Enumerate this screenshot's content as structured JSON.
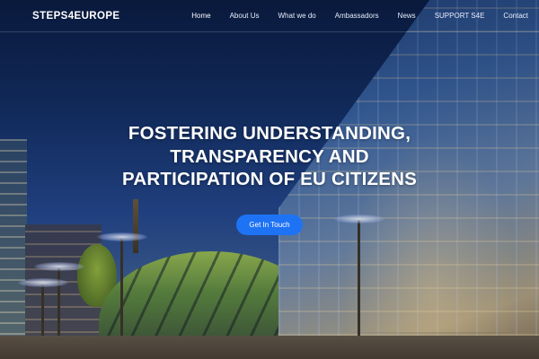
{
  "brand": {
    "logo_text": "STEPS4EUROPE"
  },
  "nav": {
    "items": [
      {
        "label": "Home",
        "active": true
      },
      {
        "label": "About Us",
        "active": false
      },
      {
        "label": "What we do",
        "active": false
      },
      {
        "label": "Ambassadors",
        "active": false
      },
      {
        "label": "News",
        "active": false
      },
      {
        "label": "SUPPORT S4E",
        "active": false
      },
      {
        "label": "Contact",
        "active": false
      }
    ]
  },
  "hero": {
    "headline": "FOSTERING UNDERSTANDING, TRANSPARENCY AND PARTICIPATION OF EU CITIZENS",
    "cta_label": "Get In Touch",
    "background": "night-city-glass-building-photo"
  },
  "colors": {
    "accent": "#1e73f5",
    "text": "#ffffff",
    "sky": "#0b1f47"
  }
}
